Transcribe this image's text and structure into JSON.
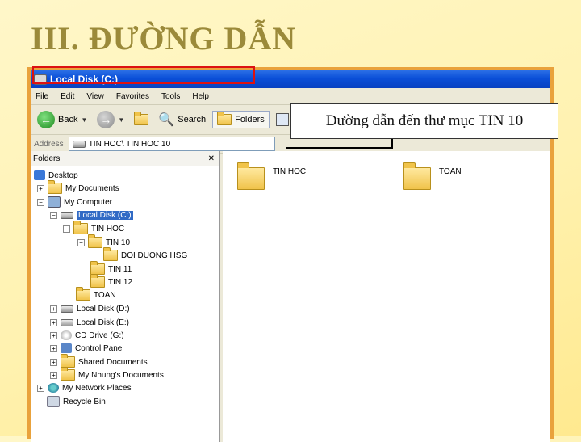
{
  "slide": {
    "title": "III. ĐƯỜNG DẪN"
  },
  "window": {
    "title": "Local Disk (C:)",
    "menu": [
      "File",
      "Edit",
      "View",
      "Favorites",
      "Tools",
      "Help"
    ],
    "toolbar": {
      "back": "Back",
      "search": "Search",
      "folders": "Folders"
    },
    "address": {
      "label": "Address",
      "value": "TIN HOC\\ TIN HOC 10"
    }
  },
  "folders_pane": {
    "header": "Folders",
    "close": "✕",
    "nodes": [
      {
        "label": "Desktop"
      },
      {
        "label": "My Documents"
      },
      {
        "label": "My Computer"
      },
      {
        "label": "Local Disk (C:)"
      },
      {
        "label": "TIN HOC"
      },
      {
        "label": "TIN 10"
      },
      {
        "label": "DOI DUONG HSG"
      },
      {
        "label": "TIN 11"
      },
      {
        "label": "TIN 12"
      },
      {
        "label": "TOAN"
      },
      {
        "label": "Local Disk (D:)"
      },
      {
        "label": "Local Disk (E:)"
      },
      {
        "label": "CD Drive (G:)"
      },
      {
        "label": "Control Panel"
      },
      {
        "label": "Shared Documents"
      },
      {
        "label": "My Nhung's Documents"
      },
      {
        "label": "My Network Places"
      },
      {
        "label": "Recycle Bin"
      }
    ]
  },
  "right_pane": {
    "items": [
      {
        "label": "TIN HOC"
      },
      {
        "label": "TOAN"
      }
    ]
  },
  "callout": {
    "text": "Đường dẫn đến thư mục TIN 10"
  }
}
